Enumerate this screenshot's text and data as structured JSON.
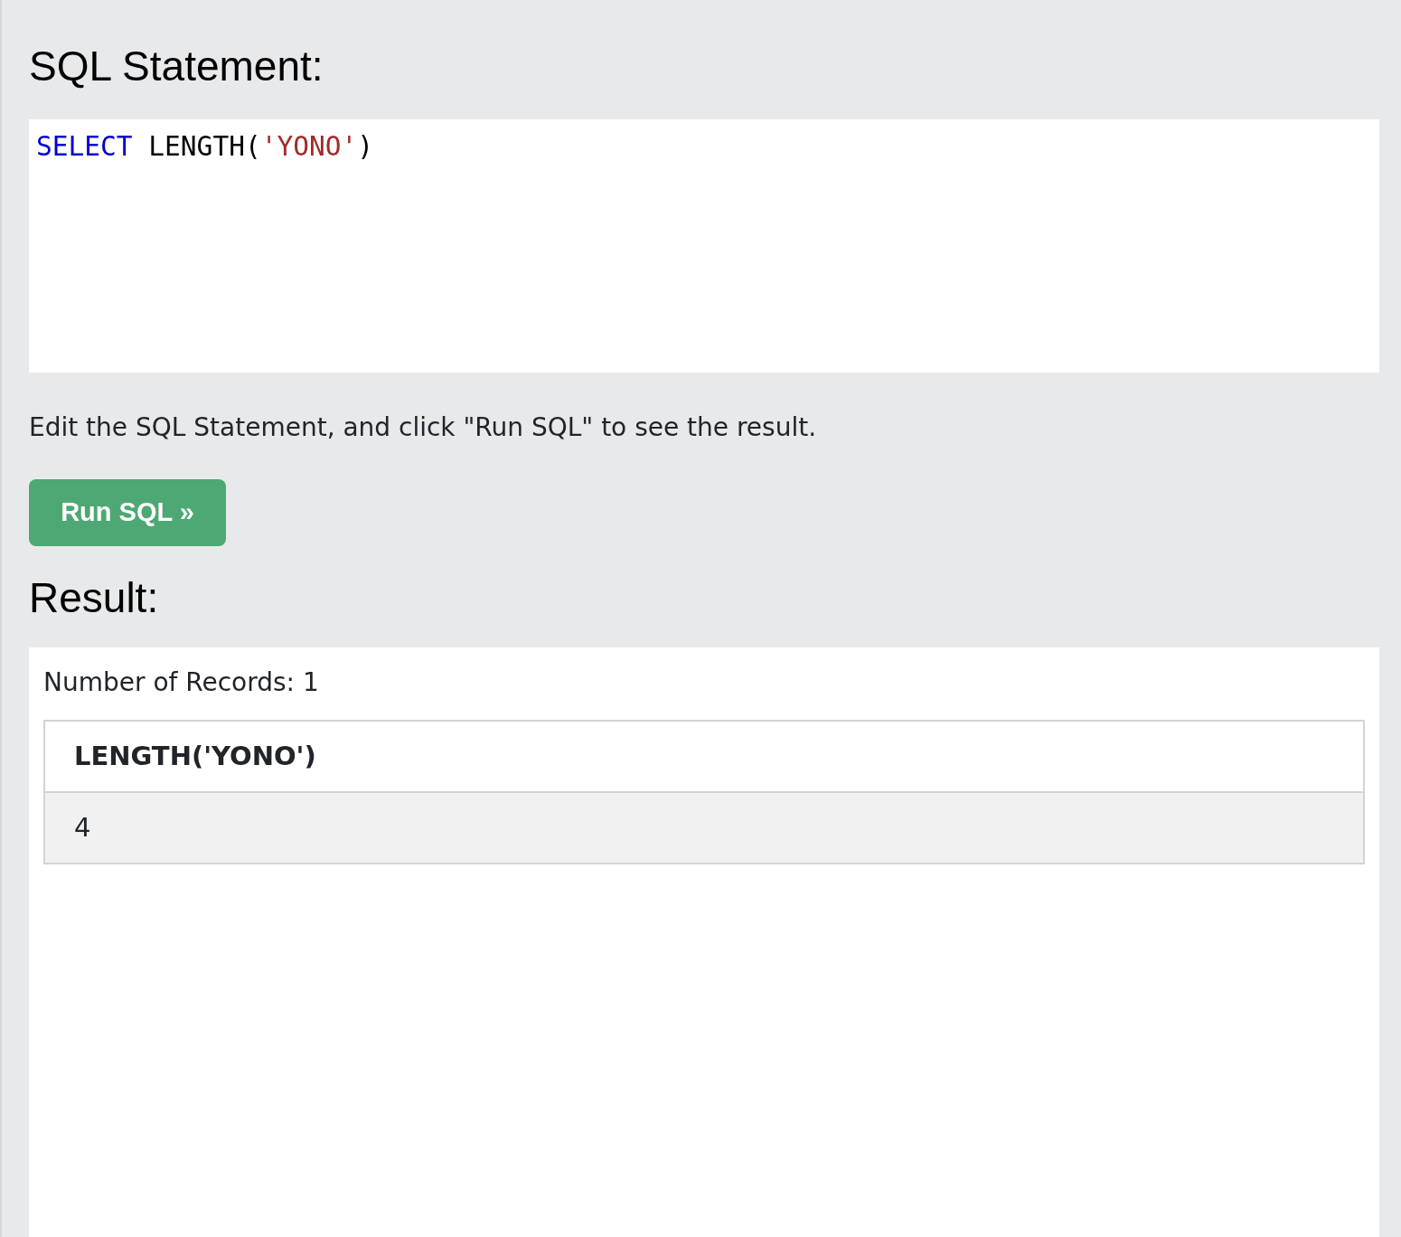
{
  "statement_heading": "SQL Statement:",
  "editor": {
    "tokens": [
      {
        "kind": "keyword",
        "text": "SELECT"
      },
      {
        "kind": "plain",
        "text": " LENGTH("
      },
      {
        "kind": "string",
        "text": "'YONO'"
      },
      {
        "kind": "plain",
        "text": ")"
      }
    ]
  },
  "instruction": "Edit the SQL Statement, and click \"Run SQL\" to see the result.",
  "run_button": "Run SQL »",
  "result_heading": "Result:",
  "result": {
    "record_count": "Number of Records: 1",
    "table": {
      "columns": [
        "LENGTH('YONO')"
      ],
      "rows": [
        [
          "4"
        ]
      ]
    }
  }
}
